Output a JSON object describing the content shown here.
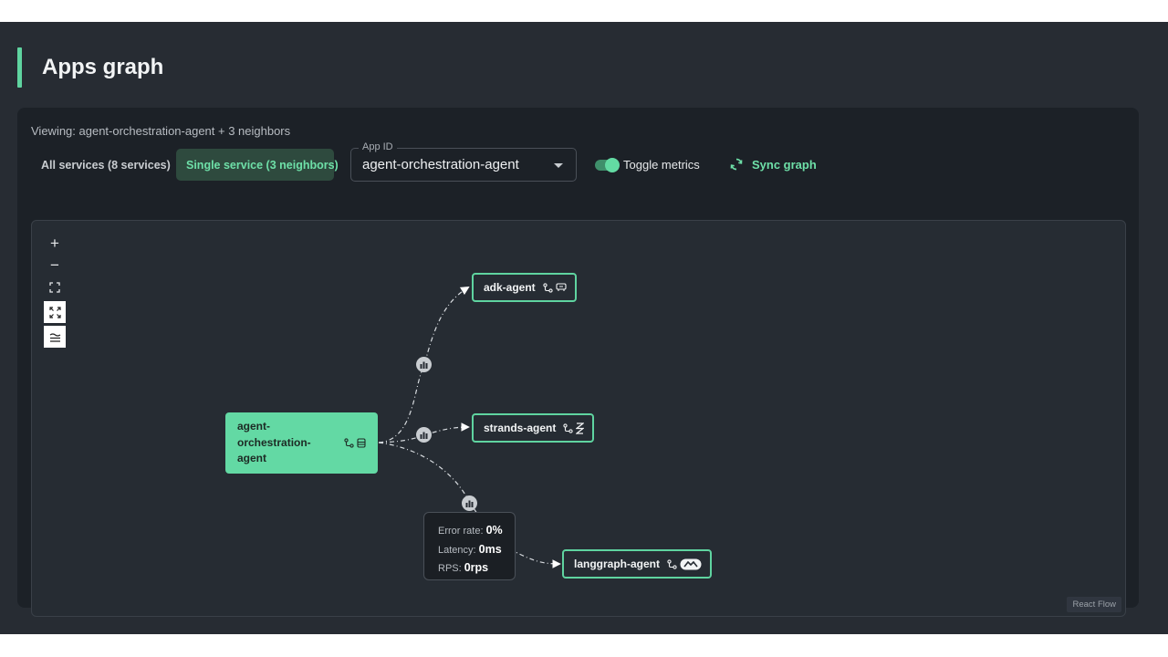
{
  "header": {
    "title": "Apps graph"
  },
  "panel": {
    "viewing_text": "Viewing: agent-orchestration-agent + 3 neighbors",
    "buttons": {
      "all_services": "All services (8 services)",
      "single_service": "Single service (3 neighbors)"
    },
    "app_select": {
      "label": "App ID",
      "value": "agent-orchestration-agent"
    },
    "toggle_metrics": {
      "label": "Toggle metrics",
      "on": true
    },
    "sync_label": "Sync graph"
  },
  "graph": {
    "zoom_in": "+",
    "zoom_out": "−",
    "nodes": {
      "main": "agent-orchestration-agent",
      "adk": "adk-agent",
      "strands": "strands-agent",
      "langgraph": "langgraph-agent"
    },
    "tooltip": {
      "error_label": "Error rate: ",
      "error_value": "0%",
      "latency_label": "Latency: ",
      "latency_value": "0ms",
      "rps_label": "RPS: ",
      "rps_value": "0rps"
    },
    "attribution": "React Flow"
  },
  "colors": {
    "accent": "#5fd4a0",
    "background": "#272c33",
    "panel": "#1c2127"
  }
}
